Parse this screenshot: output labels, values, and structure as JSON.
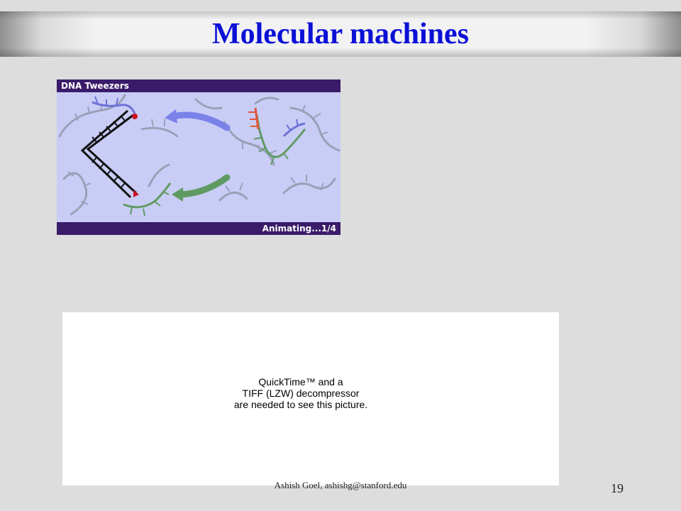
{
  "slide": {
    "title": "Molecular machines",
    "page_number": "19",
    "footer": "Ashish Goel, ashishg@stanford.edu"
  },
  "figure": {
    "header": "DNA Tweezers",
    "status": "Animating...1/4"
  },
  "placeholder": {
    "lines": [
      "QuickTime™ and a",
      "TIFF (LZW) decompressor",
      "are needed to see this picture."
    ]
  },
  "colors": {
    "title": "#0b10d6",
    "figure_frame": "#3a1b6a",
    "figure_bg": "#c9cdf6",
    "blue_arrow": "#7a82ea",
    "green_arrow": "#5f9a63"
  }
}
